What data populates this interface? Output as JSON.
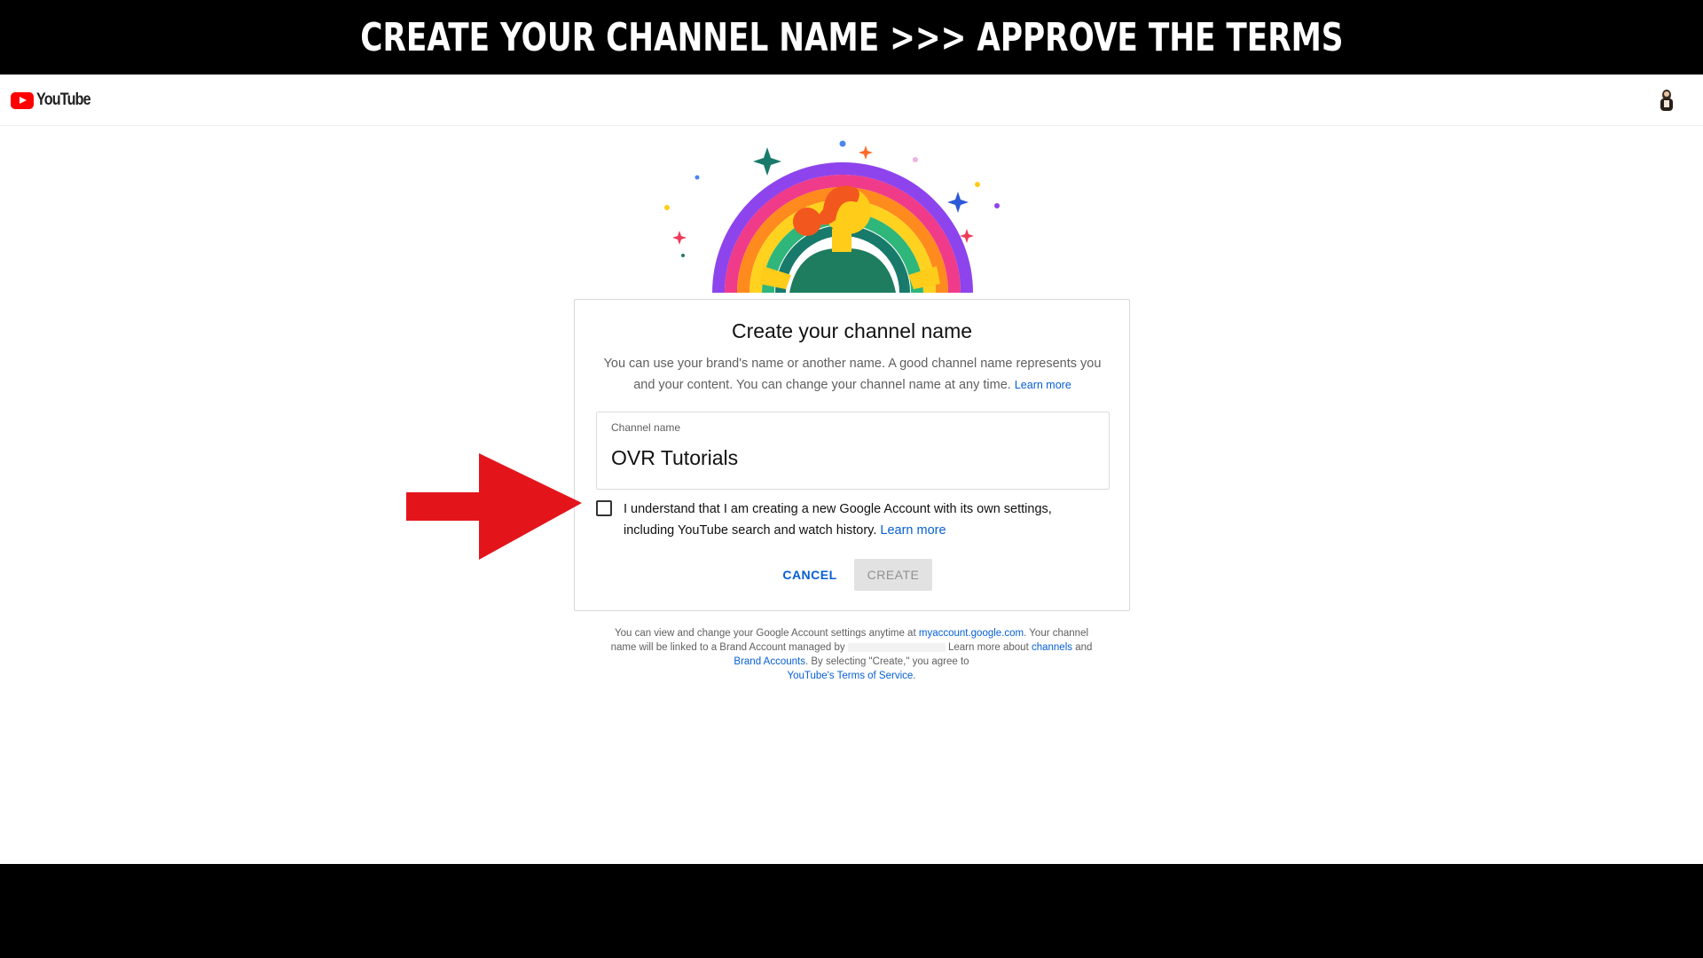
{
  "banner": {
    "text": "Create your channel name >>> Approve the terms"
  },
  "header": {
    "logo_text": "YouTube"
  },
  "dialog": {
    "title": "Create your channel name",
    "description": "You can use your brand's name or another name. A good channel name represents you and your content. You can change your channel name at any time.",
    "description_link": "Learn more",
    "field_label": "Channel name",
    "field_value": "OVR Tutorials",
    "consent_text": "I understand that I am creating a new Google Account with its own settings, including YouTube search and watch history.",
    "consent_link": "Learn more",
    "consent_checked": false,
    "cancel_label": "CANCEL",
    "create_label": "CREATE"
  },
  "footer": {
    "part1": "You can view and change your Google Account settings anytime at ",
    "link_account": "myaccount.google.com",
    "part2": ". Your channel name will be linked to a Brand Account managed by ",
    "part3": " Learn more about ",
    "link_channels": "channels",
    "part4": " and ",
    "link_brand": "Brand Accounts",
    "part5": ". By selecting \"Create,\" you agree to ",
    "link_terms": "YouTube's Terms of Service",
    "part6": "."
  },
  "colors": {
    "accent": "#065fd4",
    "logo_red": "#ff0000",
    "arrow_red": "#e3151b"
  },
  "icons": {
    "logo": "youtube-play-icon",
    "avatar": "user-avatar",
    "pointer": "red-arrow-icon"
  }
}
